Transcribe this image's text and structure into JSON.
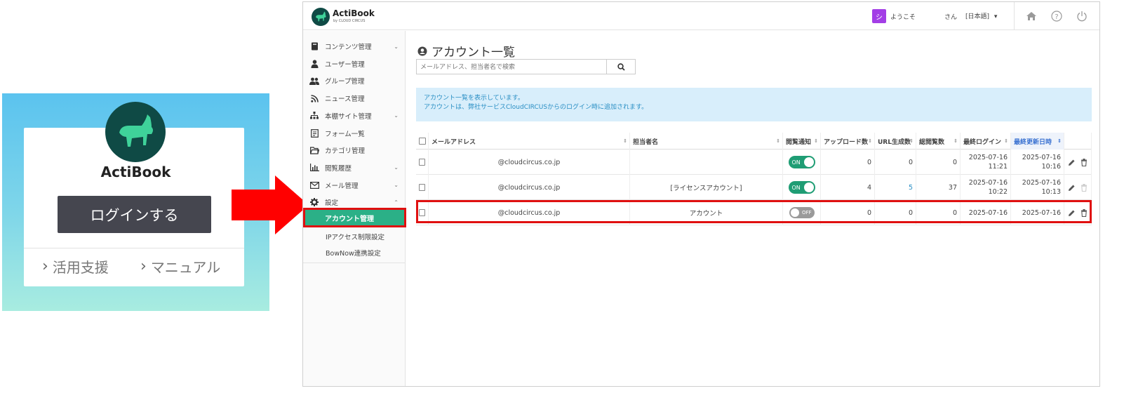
{
  "login": {
    "brand": "ActiBook",
    "login_button": "ログインする",
    "link_support": "活用支援",
    "link_manual": "マニュアル"
  },
  "header": {
    "brand": "ActiBook",
    "brand_sub": "by CLOUD CIRCUS",
    "avatar_initial": "シ",
    "welcome": "ようこそ",
    "user_suffix": "さん",
    "language": "[日本語]"
  },
  "sidebar": {
    "items": [
      {
        "label": "コンテンツ管理",
        "icon": "book-icon",
        "expandable": true
      },
      {
        "label": "ユーザー管理",
        "icon": "user-icon",
        "expandable": false
      },
      {
        "label": "グループ管理",
        "icon": "users-icon",
        "expandable": false
      },
      {
        "label": "ニュース管理",
        "icon": "rss-icon",
        "expandable": false
      },
      {
        "label": "本棚サイト管理",
        "icon": "sitemap-icon",
        "expandable": true
      },
      {
        "label": "フォーム一覧",
        "icon": "form-icon",
        "expandable": false
      },
      {
        "label": "カテゴリ管理",
        "icon": "folder-icon",
        "expandable": false
      },
      {
        "label": "閲覧履歴",
        "icon": "bar-chart-icon",
        "expandable": true
      },
      {
        "label": "メール管理",
        "icon": "mail-icon",
        "expandable": true
      },
      {
        "label": "設定",
        "icon": "gear-icon",
        "expandable": true
      }
    ],
    "settings_sub": [
      "アカウント管理",
      "IPアクセス制限設定",
      "BowNow連携設定"
    ]
  },
  "main": {
    "title": "アカウント一覧",
    "search_placeholder": "メールアドレス、担当者名で検索",
    "info_line1": "アカウント一覧を表示しています。",
    "info_line2": "アカウントは、弊社サービスCloudCIRCUSからのログイン時に追加されます。",
    "columns": [
      "メールアドレス",
      "担当者名",
      "閲覧通知",
      "アップロード数",
      "URL生成数",
      "総閲覧数",
      "最終ログイン",
      "最終更新日時"
    ],
    "rows": [
      {
        "email": "@cloudcircus.co.jp",
        "name": "",
        "notify": "ON",
        "uploads": "0",
        "urls": "0",
        "views": "0",
        "last_login_date": "2025-07-16",
        "last_login_time": "11:21",
        "updated_date": "2025-07-16",
        "updated_time": "10:16"
      },
      {
        "email": "@cloudcircus.co.jp",
        "name": "[ライセンスアカウント]",
        "notify": "ON",
        "uploads": "4",
        "urls": "5",
        "views": "37",
        "last_login_date": "2025-07-16",
        "last_login_time": "10:22",
        "updated_date": "2025-07-16",
        "updated_time": "10:13"
      },
      {
        "email": "@cloudcircus.co.jp",
        "name": "アカウント",
        "notify": "OFF",
        "uploads": "0",
        "urls": "0",
        "views": "0",
        "last_login_date": "2025-07-16",
        "last_login_time": "",
        "updated_date": "2025-07-16",
        "updated_time": ""
      }
    ]
  },
  "colors": {
    "accent_green": "#2bb087",
    "highlight_red": "#e01010",
    "info_bg": "#d8eefb",
    "link_blue": "#2a8fc4"
  }
}
